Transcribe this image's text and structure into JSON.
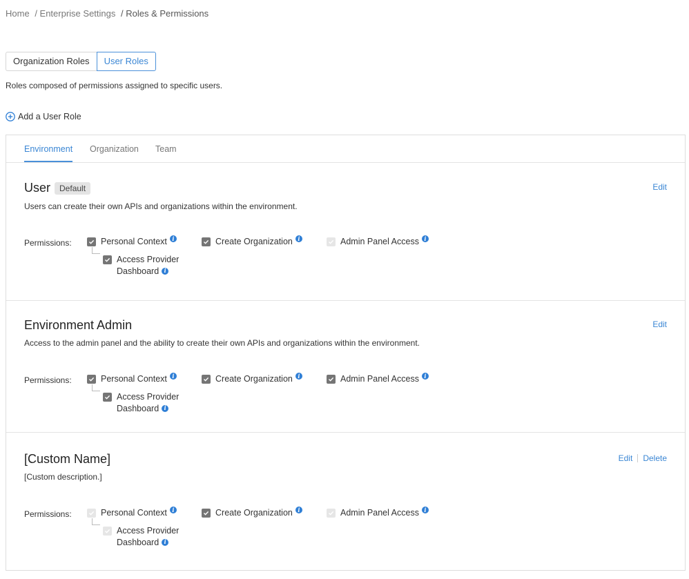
{
  "breadcrumb": {
    "items": [
      "Home",
      "/ Enterprise Settings",
      "/ Roles & Permissions"
    ]
  },
  "role_type_tabs": {
    "items": [
      "Organization Roles",
      "User Roles"
    ],
    "active": "User Roles"
  },
  "subtitle": "Roles composed of permissions assigned to specific users.",
  "add_role_label": "Add a User Role",
  "scope_tabs": {
    "items": [
      "Environment",
      "Organization",
      "Team"
    ],
    "active": "Environment"
  },
  "colors": {
    "accent": "#3a86d4",
    "checkbox_checked": "#757575",
    "checkbox_disabled": "#e6e6e6",
    "info_icon": "#2f7fd6"
  },
  "permissions_label": "Permissions:",
  "roles": [
    {
      "name": "User",
      "badge": "Default",
      "description": "Users can create their own APIs and organizations within the environment.",
      "actions": [
        "Edit"
      ],
      "permissions": {
        "personal_context": {
          "label": "Personal Context",
          "state": "checked"
        },
        "access_provider_dashboard": {
          "label_1": "Access Provider",
          "label_2": "Dashboard",
          "state": "checked"
        },
        "create_organization": {
          "label": "Create Organization",
          "state": "checked"
        },
        "admin_panel_access": {
          "label": "Admin Panel Access",
          "state": "disabled"
        }
      }
    },
    {
      "name": "Environment Admin",
      "badge": "",
      "description": "Access to the admin panel and the ability to create their own APIs and organizations within the environment.",
      "actions": [
        "Edit"
      ],
      "permissions": {
        "personal_context": {
          "label": "Personal Context",
          "state": "checked"
        },
        "access_provider_dashboard": {
          "label_1": "Access Provider",
          "label_2": "Dashboard",
          "state": "checked"
        },
        "create_organization": {
          "label": "Create Organization",
          "state": "checked"
        },
        "admin_panel_access": {
          "label": "Admin Panel Access",
          "state": "checked"
        }
      }
    },
    {
      "name": "[Custom Name]",
      "badge": "",
      "description": "[Custom description.]",
      "actions": [
        "Edit",
        "Delete"
      ],
      "permissions": {
        "personal_context": {
          "label": "Personal Context",
          "state": "disabled"
        },
        "access_provider_dashboard": {
          "label_1": "Access Provider",
          "label_2": "Dashboard",
          "state": "disabled"
        },
        "create_organization": {
          "label": "Create Organization",
          "state": "checked"
        },
        "admin_panel_access": {
          "label": "Admin Panel Access",
          "state": "disabled"
        }
      }
    }
  ]
}
